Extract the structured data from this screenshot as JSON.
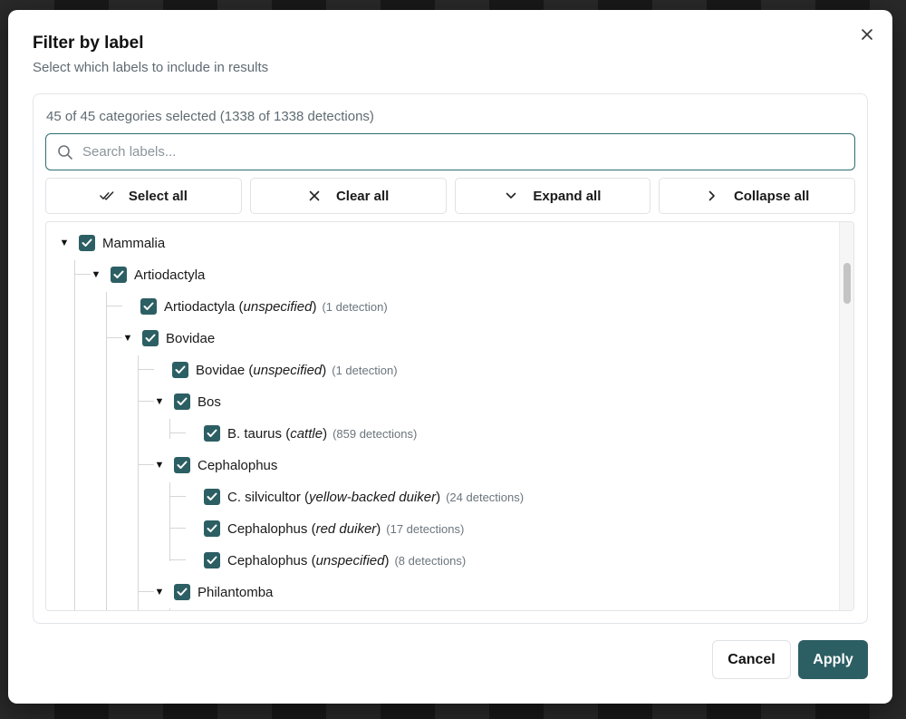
{
  "dialog": {
    "title": "Filter by label",
    "subtitle": "Select which labels to include in results",
    "summary": "45 of 45 categories selected (1338 of 1338 detections)",
    "search_placeholder": "Search labels...",
    "toolbar": {
      "select_all": "Select all",
      "clear_all": "Clear all",
      "expand_all": "Expand all",
      "collapse_all": "Collapse all"
    },
    "cancel_label": "Cancel",
    "apply_label": "Apply"
  },
  "colors": {
    "accent": "#2c5f63",
    "focus": "#2c6e73"
  },
  "tree": [
    {
      "label": "Mammalia",
      "qualifier": "",
      "suffix": "",
      "count": "",
      "checked": true,
      "expanded": true
    },
    {
      "label": "Artiodactyla",
      "qualifier": "",
      "suffix": "",
      "count": "",
      "checked": true,
      "expanded": true
    },
    {
      "label": "Artiodactyla (",
      "qualifier": "unspecified",
      "suffix": ")",
      "count": "(1 detection)",
      "checked": true
    },
    {
      "label": "Bovidae",
      "qualifier": "",
      "suffix": "",
      "count": "",
      "checked": true,
      "expanded": true
    },
    {
      "label": "Bovidae (",
      "qualifier": "unspecified",
      "suffix": ")",
      "count": "(1 detection)",
      "checked": true
    },
    {
      "label": "Bos",
      "qualifier": "",
      "suffix": "",
      "count": "",
      "checked": true,
      "expanded": true
    },
    {
      "label": "B. taurus (",
      "qualifier": "cattle",
      "suffix": ")",
      "count": "(859 detections)",
      "checked": true
    },
    {
      "label": "Cephalophus",
      "qualifier": "",
      "suffix": "",
      "count": "",
      "checked": true,
      "expanded": true
    },
    {
      "label": "C. silvicultor (",
      "qualifier": "yellow-backed duiker",
      "suffix": ")",
      "count": "(24 detections)",
      "checked": true
    },
    {
      "label": "Cephalophus (",
      "qualifier": "red duiker",
      "suffix": ")",
      "count": "(17 detections)",
      "checked": true
    },
    {
      "label": "Cephalophus (",
      "qualifier": "unspecified",
      "suffix": ")",
      "count": "(8 detections)",
      "checked": true
    },
    {
      "label": "Philantomba",
      "qualifier": "",
      "suffix": "",
      "count": "",
      "checked": true,
      "expanded": true
    }
  ]
}
